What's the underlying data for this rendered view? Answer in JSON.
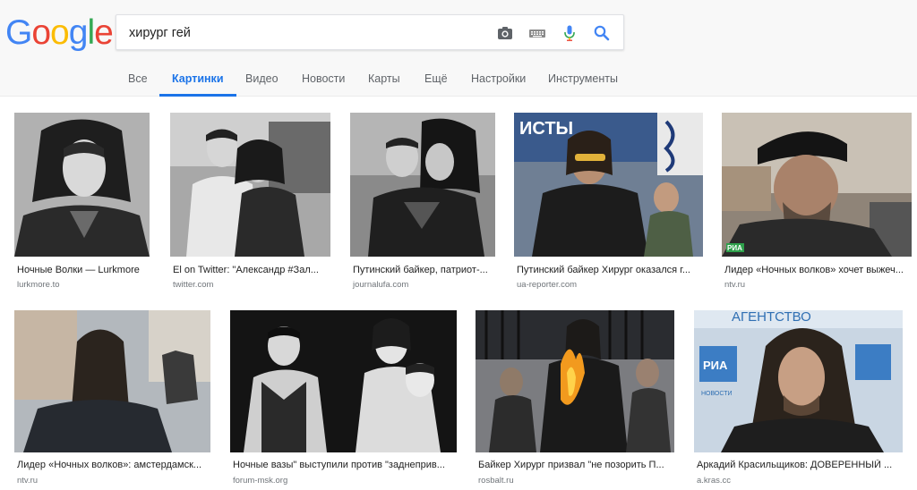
{
  "search": {
    "query": "хирург гей"
  },
  "brand": {
    "letters": [
      "G",
      "o",
      "o",
      "g",
      "l",
      "e"
    ],
    "colors": [
      "#4285F4",
      "#EA4335",
      "#FBBC05",
      "#4285F4",
      "#34A853",
      "#EA4335"
    ]
  },
  "tabs": [
    {
      "label": "Все"
    },
    {
      "label": "Картинки"
    },
    {
      "label": "Видео"
    },
    {
      "label": "Новости"
    },
    {
      "label": "Карты"
    },
    {
      "label": "Ещё"
    },
    {
      "label": "Настройки"
    },
    {
      "label": "Инструменты"
    }
  ],
  "active_tab": "Картинки",
  "results": [
    {
      "title": "Ночные Волки — Lurkmore",
      "source": "lurkmore.to"
    },
    {
      "title": "El on Twitter: \"Александр #Зал...",
      "source": "twitter.com"
    },
    {
      "title": "Путинский байкер, патриот-...",
      "source": "journalufa.com"
    },
    {
      "title": "Путинский байкер Хирург оказался г...",
      "source": "ua-reporter.com"
    },
    {
      "title": "Лидер «Ночных волков» хочет выжеч...",
      "source": "ntv.ru"
    },
    {
      "title": "Лидер «Ночных волков»: амстердамск...",
      "source": "ntv.ru"
    },
    {
      "title": "Ночные вазы\" выступили против \"заднеприв...",
      "source": "forum-msk.org"
    },
    {
      "title": "Байкер Хирург призвал \"не позорить П...",
      "source": "rosbalt.ru"
    },
    {
      "title": "Аркадий Красильщиков: ДОВЕРЕННЫЙ ...",
      "source": "a.kras.cc"
    }
  ],
  "image_text": {
    "r1_4": "ИСТЫ",
    "r2_4_a": "АГЕНТСТВО",
    "r2_4_b": "НОВОСТИ",
    "r2_4_c": "РИА",
    "r1_5": "РИА"
  },
  "icons": [
    "camera-icon",
    "keyboard-icon",
    "mic-icon",
    "search-icon"
  ]
}
